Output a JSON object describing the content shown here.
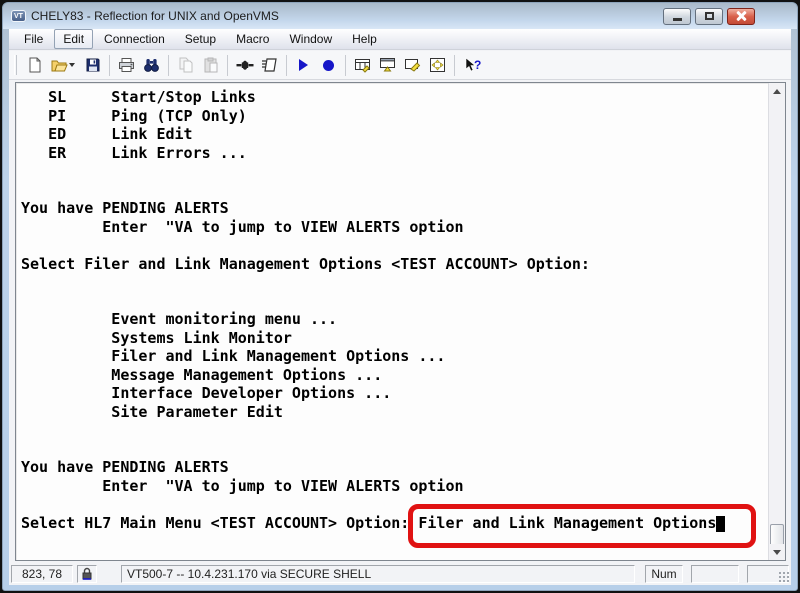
{
  "window": {
    "icon_text": "VT",
    "title": "CHELY83 - Reflection for UNIX and OpenVMS"
  },
  "menubar": {
    "items": [
      "File",
      "Edit",
      "Connection",
      "Setup",
      "Macro",
      "Window",
      "Help"
    ],
    "active_item": "Edit"
  },
  "toolbar": {
    "icons": [
      "new-document-icon",
      "open-folder-icon",
      "save-icon",
      "print-icon",
      "find-icon",
      "copy-icon",
      "paste-icon",
      "connect-icon",
      "run-script-icon",
      "play-macro-icon",
      "record-macro-icon",
      "keyboard-map-icon",
      "display-setup-icon",
      "mouse-map-icon",
      "hotspots-icon",
      "context-help-icon"
    ],
    "help_glyph": "?"
  },
  "terminal": {
    "screen_text": "   SL     Start/Stop Links\n   PI     Ping (TCP Only)\n   ED     Link Edit\n   ER     Link Errors ...\n\n\nYou have PENDING ALERTS\n         Enter  \"VA to jump to VIEW ALERTS option\n\nSelect Filer and Link Management Options <TEST ACCOUNT> Option:\n\n\n          Event monitoring menu ...\n          Systems Link Monitor\n          Filer and Link Management Options ...\n          Message Management Options ...\n          Interface Developer Options ...\n          Site Parameter Edit\n\n\nYou have PENDING ALERTS\n         Enter  \"VA to jump to VIEW ALERTS option\n\nSelect HL7 Main Menu <TEST ACCOUNT> Option: Filer and Link Management Options",
    "highlighted_text": "Filer and Link Management Options",
    "highlight_color": "#e01212"
  },
  "statusbar": {
    "cursor_position": "823, 78",
    "connection_info": "VT500-7 -- 10.4.231.170 via SECURE SHELL",
    "num_lock": "Num"
  }
}
